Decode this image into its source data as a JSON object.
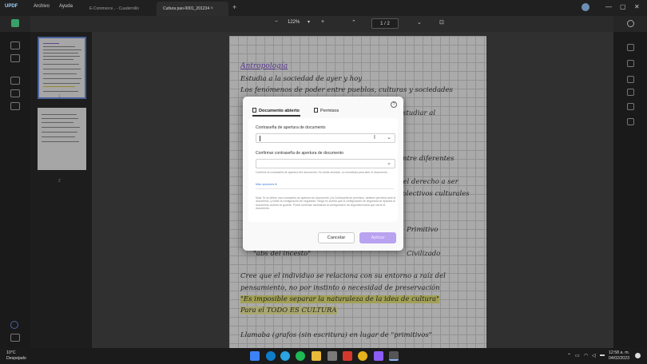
{
  "app": {
    "logo": "UPDF",
    "menu_archivo": "Archivo",
    "menu_ayuda": "Ayuda",
    "tabs": [
      "E-Commerce.. - Cuadernillo",
      "Cultura pao-0001_201234"
    ],
    "new_tab": "+",
    "tab_close": "×"
  },
  "toolbar": {
    "zoom": "122%",
    "zoom_minus": "−",
    "zoom_plus": "+",
    "page_current": "1",
    "page_sep": "/",
    "page_total": "2",
    "page_up": "⌃",
    "page_down": "⌄"
  },
  "thumbnails": [
    {
      "label": "1"
    },
    {
      "label": "2"
    }
  ],
  "document": {
    "lines": [
      "Antropología",
      "Estudia a la sociedad de ayer y hoy",
      "Los fenómenos de poder entre pueblos, culturas y sociedades",
      "estudiar al",
      "entre diferentes",
      "del derecho a ser",
      "colectivos culturales",
      "Primitivo",
      "\"abs del incesto\"",
      "Civilizado",
      "Cree que el individuo se relaciona con su entorno a raíz del",
      "pensamiento, no por instinto o necesidad de preservación",
      "\"Es imposible separar la naturaleza de la idea de cultura\"",
      "Para el TODO ES CULTURA",
      "Llamaba (grafos (sin escritura) en lugar de \"primitivos\""
    ]
  },
  "dialog": {
    "tab_open": "Documento abierto",
    "tab_perms": "Permisos",
    "label_password": "Contraseña de apertura de documento",
    "label_confirm": "Confirmar contraseña de apertura de documento",
    "hint": "Confirme la contraseña de apertura del documento. No olvide anotarla. La necesitará para abrir el documento.",
    "more": "Más opciones ▾",
    "note": "Nota: Si se define una contraseña de apertura de documento y la Contraseña de permisos, también permitirá abrir el documento, y editar la configuración de seguridad. Tenga en cuenta que la configuración de seguridad se aplicará al documento cuando se guarde. Podrá continuar cambiando la configuración de seguridad hasta que cierre el documento.",
    "cancel": "Cancelar",
    "apply": "Aplicar",
    "help": "?",
    "chevron": "⌄",
    "ibeam": "I"
  },
  "taskbar": {
    "temperature": "10°C",
    "weather": "Despejado",
    "time": "12:58 a. m.",
    "date": "04/02/2023"
  },
  "colors": {
    "accent": "#b9a2f0",
    "title_purple": "#7a4cc8",
    "highlight": "#e7e67a"
  }
}
